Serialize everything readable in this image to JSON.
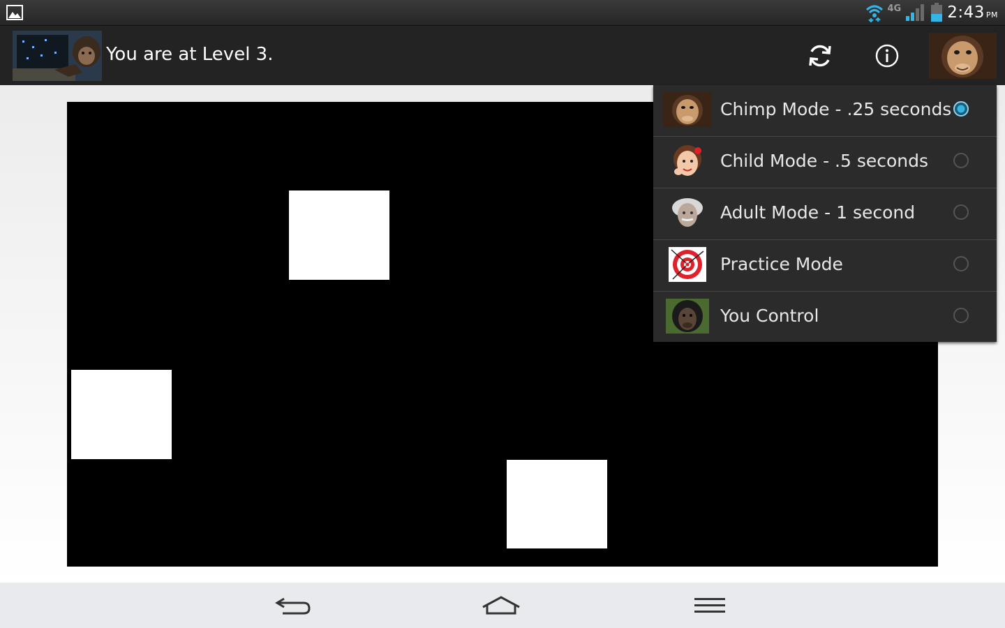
{
  "status_bar": {
    "time": "2:43",
    "ampm": "PM",
    "network": "4G",
    "icons": [
      "gallery-icon",
      "wifi-icon",
      "signal-icon",
      "battery-icon"
    ]
  },
  "action_bar": {
    "title": "You are at Level 3.",
    "icons": [
      "app-icon",
      "refresh-icon",
      "info-icon",
      "mode-icon"
    ]
  },
  "game": {
    "board_color": "#000000",
    "tile_color": "#ffffff",
    "tiles_visible": 3
  },
  "mode_menu": {
    "items": [
      {
        "label": "Chimp Mode - .25 seconds",
        "icon": "chimp-face-icon",
        "selected": true
      },
      {
        "label": "Child Mode - .5 seconds",
        "icon": "child-face-icon",
        "selected": false
      },
      {
        "label": "Adult Mode - 1 second",
        "icon": "adult-face-icon",
        "selected": false
      },
      {
        "label": "Practice Mode",
        "icon": "target-icon",
        "selected": false
      },
      {
        "label": "You Control",
        "icon": "chimp-icon",
        "selected": false
      }
    ],
    "accent": "#35b5e5"
  },
  "nav_bar": {
    "icons": [
      "back-icon",
      "home-icon",
      "menu-icon"
    ]
  }
}
